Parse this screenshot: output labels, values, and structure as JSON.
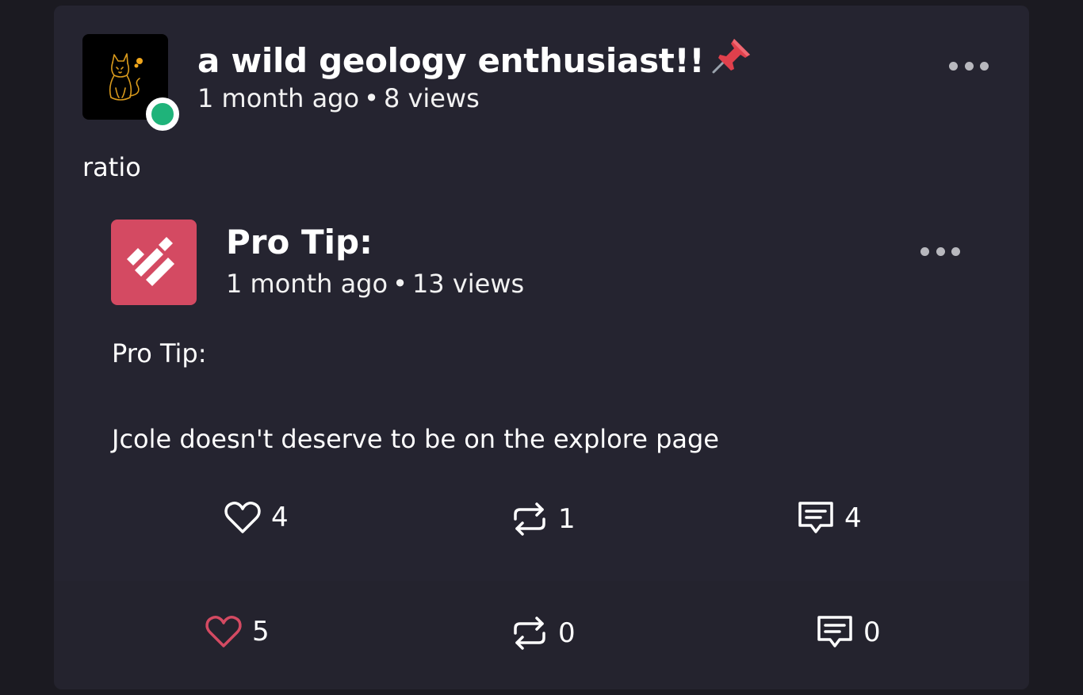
{
  "post": {
    "author_name": "a wild geology enthusiast!!",
    "pin_icon": "pushpin-icon",
    "time_ago": "1 month ago",
    "separator": "•",
    "views": "8 views",
    "body": "ratio",
    "online_status_color": "#1fb37a"
  },
  "quoted_post": {
    "author_name": "Pro Tip:",
    "time_ago": "1 month ago",
    "separator": "•",
    "views": "13 views",
    "body_line1": "Pro Tip:",
    "body_line2": "Jcole doesn't deserve to be on the explore page",
    "avatar_color": "#d44a62",
    "stats": {
      "likes": "4",
      "reposts": "1",
      "comments": "4"
    }
  },
  "actions": {
    "likes": "5",
    "reposts": "0",
    "comments": "0",
    "liked_color": "#d44a62"
  }
}
